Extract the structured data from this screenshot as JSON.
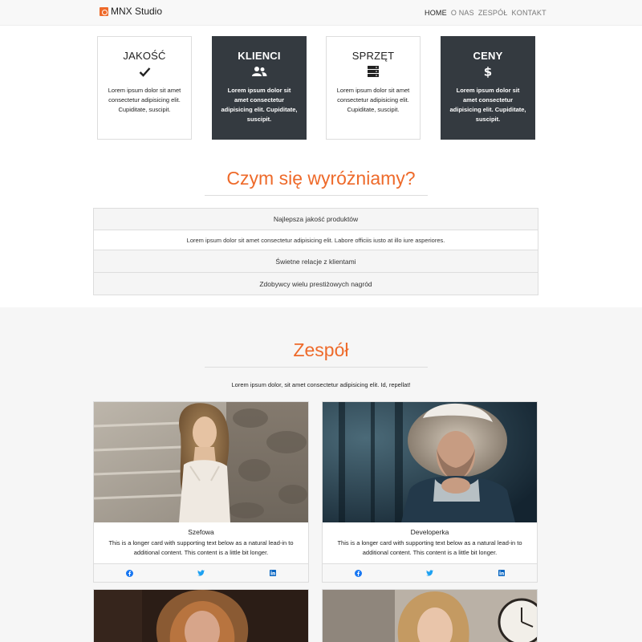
{
  "brand": {
    "name": "MNX Studio"
  },
  "nav": {
    "items": [
      "HOME",
      "O NAS",
      "ZESPÓŁ",
      "KONTAKT"
    ]
  },
  "features": [
    {
      "title": "JAKOŚĆ",
      "icon": "check-icon",
      "text": "Lorem ipsum dolor sit amet consectetur adipisicing elit. Cupiditate, suscipit."
    },
    {
      "title": "KLIENCI",
      "icon": "users-icon",
      "text": "Lorem ipsum dolor sit amet consectetur adipisicing elit. Cupiditate, suscipit."
    },
    {
      "title": "SPRZĘT",
      "icon": "server-icon",
      "text": "Lorem ipsum dolor sit amet consectetur adipisicing elit. Cupiditate, suscipit."
    },
    {
      "title": "CENY",
      "icon": "dollar-icon",
      "text": "Lorem ipsum dolor sit amet consectetur adipisicing elit. Cupiditate, suscipit."
    }
  ],
  "about": {
    "title": "Czym się wyróżniamy?",
    "accordion": [
      {
        "header": "Najlepsza jakość produktów",
        "body": "Lorem ipsum dolor sit amet consectetur adipisicing elit. Labore officiis iusto at illo iure asperiores."
      },
      {
        "header": "Świetne relacje z klientami"
      },
      {
        "header": "Zdobywcy wielu prestiżowych nagród"
      }
    ]
  },
  "team": {
    "title": "Zespół",
    "lead": "Lorem ipsum dolor, sit amet consectetur adipisicing elit. Id, repellat!",
    "members": [
      {
        "name": "Szefowa",
        "text": "This is a longer card with supporting text below as a natural lead-in to additional content. This content is a little bit longer."
      },
      {
        "name": "Developerka",
        "text": "This is a longer card with supporting text below as a natural lead-in to additional content. This content is a little bit longer."
      }
    ],
    "social_icons": [
      "facebook-icon",
      "twitter-icon",
      "linkedin-icon"
    ]
  },
  "colors": {
    "accent": "#ee6a2a",
    "dark": "#343a40",
    "social": "#1877f2"
  }
}
